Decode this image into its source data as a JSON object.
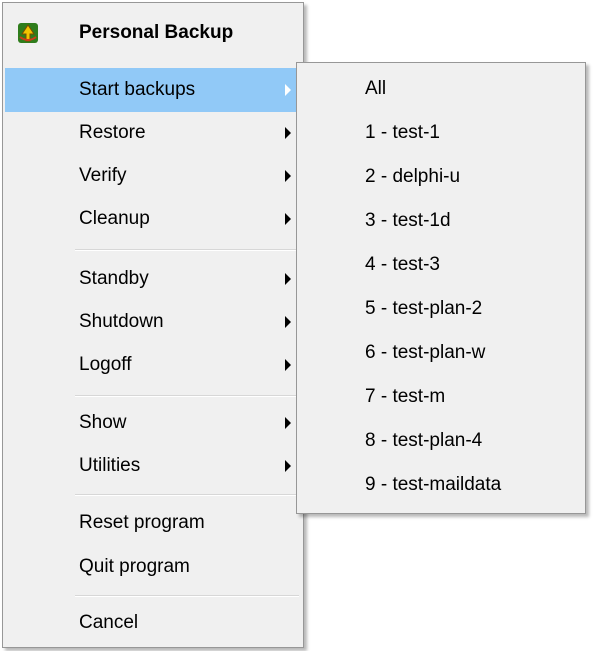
{
  "main_menu": {
    "header": {
      "title": "Personal Backup",
      "icon": "personal-backup-app-icon"
    },
    "items": [
      {
        "label": "Start backups",
        "has_submenu": true,
        "selected": true
      },
      {
        "label": "Restore",
        "has_submenu": true
      },
      {
        "label": "Verify",
        "has_submenu": true
      },
      {
        "label": "Cleanup",
        "has_submenu": true
      },
      {
        "label": "Standby",
        "has_submenu": true
      },
      {
        "label": "Shutdown",
        "has_submenu": true
      },
      {
        "label": "Logoff",
        "has_submenu": true
      },
      {
        "label": "Show",
        "has_submenu": true
      },
      {
        "label": "Utilities",
        "has_submenu": true
      },
      {
        "label": "Reset program",
        "has_submenu": false
      },
      {
        "label": "Quit program",
        "has_submenu": false
      },
      {
        "label": "Cancel",
        "has_submenu": false
      }
    ]
  },
  "submenu": {
    "items": [
      {
        "label": "All"
      },
      {
        "label": "1 - test-1"
      },
      {
        "label": "2 - delphi-u"
      },
      {
        "label": "3 - test-1d"
      },
      {
        "label": "4 - test-3"
      },
      {
        "label": "5 - test-plan-2"
      },
      {
        "label": "6 - test-plan-w"
      },
      {
        "label": "7 - test-m"
      },
      {
        "label": "8 - test-plan-4"
      },
      {
        "label": "9 - test-maildata"
      }
    ]
  },
  "colors": {
    "menu_background": "#f0f0f0",
    "selection": "#91c9f7",
    "border": "#979797",
    "separator": "#d7d7d7"
  }
}
